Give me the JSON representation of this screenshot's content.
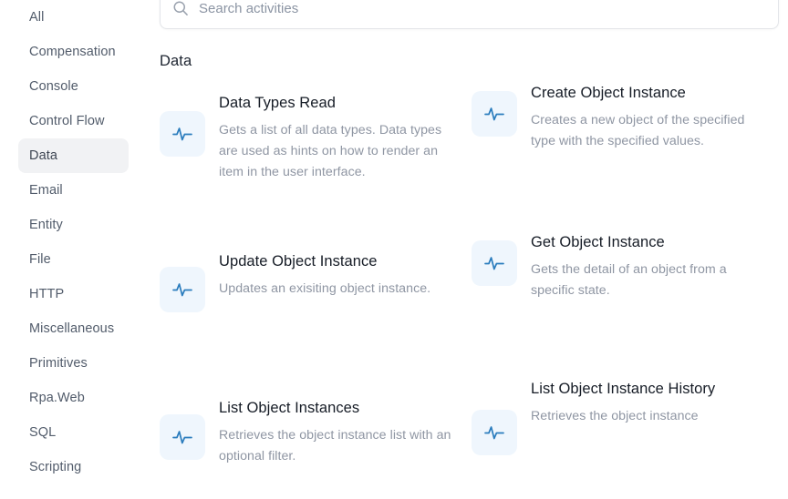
{
  "search": {
    "placeholder": "Search activities",
    "value": "",
    "icon": "search-icon"
  },
  "sidebar": {
    "items": [
      {
        "label": "All",
        "active": false
      },
      {
        "label": "Compensation",
        "active": false
      },
      {
        "label": "Console",
        "active": false
      },
      {
        "label": "Control Flow",
        "active": false
      },
      {
        "label": "Data",
        "active": true
      },
      {
        "label": "Email",
        "active": false
      },
      {
        "label": "Entity",
        "active": false
      },
      {
        "label": "File",
        "active": false
      },
      {
        "label": "HTTP",
        "active": false
      },
      {
        "label": "Miscellaneous",
        "active": false
      },
      {
        "label": "Primitives",
        "active": false
      },
      {
        "label": "Rpa.Web",
        "active": false
      },
      {
        "label": "SQL",
        "active": false
      },
      {
        "label": "Scripting",
        "active": false
      }
    ]
  },
  "main": {
    "section_title": "Data",
    "cards": [
      {
        "title": "Data Types Read",
        "description": "Gets a list of all data types. Data types are used as hints on how to render an item in the user interface.",
        "icon": "activity-pulse-icon"
      },
      {
        "title": "Create Object Instance",
        "description": "Creates a new object of the specified type with the specified values.",
        "icon": "activity-pulse-icon"
      },
      {
        "title": "Update Object Instance",
        "description": "Updates an exisiting object instance.",
        "icon": "activity-pulse-icon"
      },
      {
        "title": "Get Object Instance",
        "description": "Gets the detail of an object from a specific state.",
        "icon": "activity-pulse-icon"
      },
      {
        "title": "List Object Instances",
        "description": "Retrieves the object instance list with an optional filter.",
        "icon": "activity-pulse-icon"
      },
      {
        "title": "List Object Instance History",
        "description": "Retrieves the object instance",
        "icon": "activity-pulse-icon"
      }
    ]
  },
  "colors": {
    "icon_tile_bg": "#eff6fd",
    "icon_stroke": "#2a7cbd",
    "active_item_bg": "#f1f2f4",
    "title_text": "#161c26",
    "desc_text": "#8f96a3",
    "sidebar_text": "#525c6b"
  }
}
